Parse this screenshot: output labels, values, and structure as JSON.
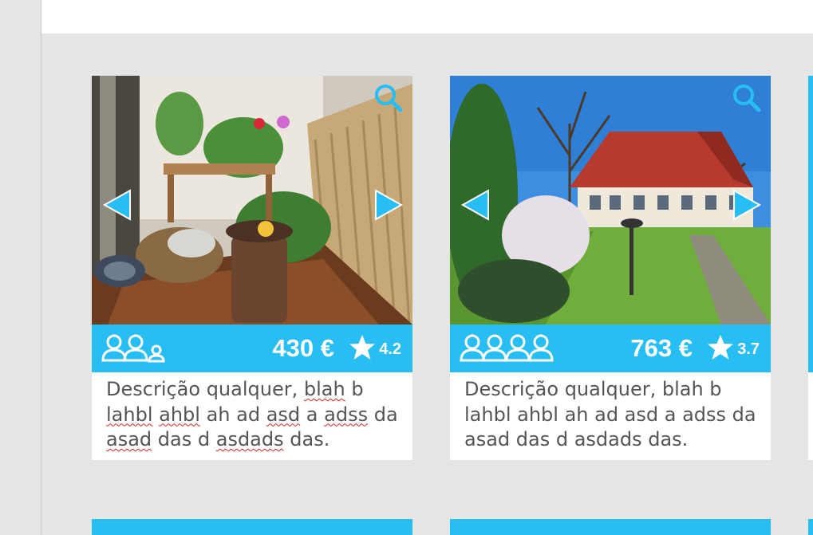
{
  "colors": {
    "accent": "#28bdf3",
    "background": "#e5e5e5",
    "card": "#ffffff",
    "text": "#555555"
  },
  "listings": [
    {
      "guests": 2,
      "guest_icons": [
        "person-icon",
        "person-icon",
        "person-small-icon"
      ],
      "price": "430 €",
      "rating": "4.2",
      "description_parts": [
        "Descrição qualquer, ",
        "blah",
        " b ",
        "lahbl",
        " ",
        "ahbl",
        " ah ad ",
        "asd",
        " a ",
        "adss",
        " da ",
        "asad",
        " das d ",
        "asdads",
        " das."
      ]
    },
    {
      "guests": 4,
      "guest_icons": [
        "person-icon",
        "person-icon",
        "person-icon",
        "person-icon"
      ],
      "price": "763 €",
      "rating": "3.7",
      "description": "Descrição qualquer, blah b lahbl ahbl ah ad asd a adss da asad das d asdads das."
    }
  ]
}
